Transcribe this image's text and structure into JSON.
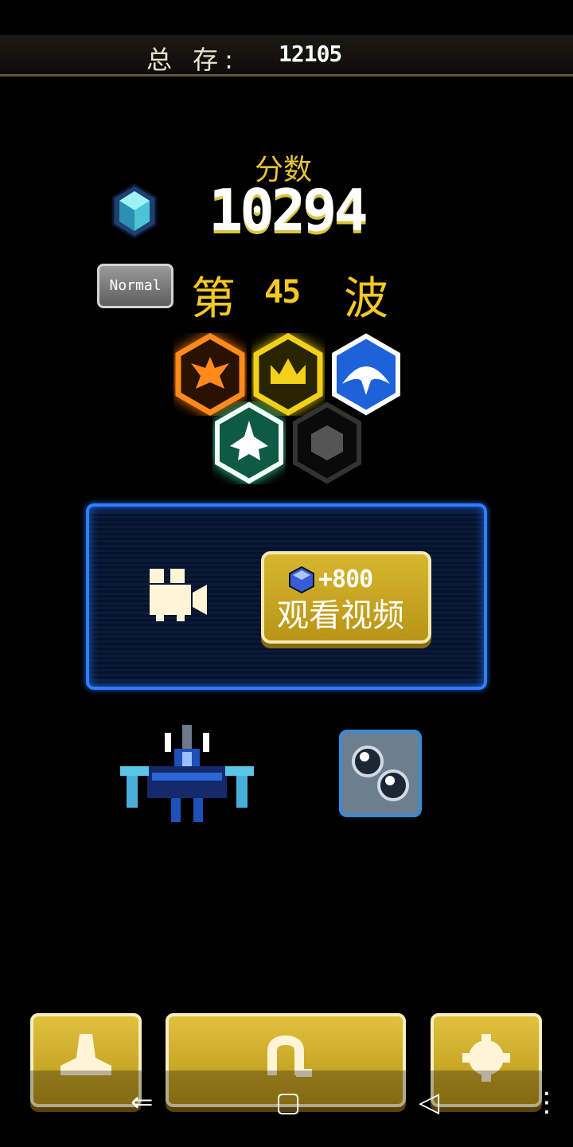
{
  "top_bar": {
    "total_label": "总 存:",
    "total_value": "12105"
  },
  "score": {
    "label": "分数",
    "value": "10294"
  },
  "difficulty": {
    "badge": "Normal"
  },
  "wave": {
    "prefix": "第",
    "number": "45",
    "suffix": "波"
  },
  "achievements": [
    {
      "name": "phoenix",
      "color": "#ff8a1a",
      "state": "unlocked"
    },
    {
      "name": "crown",
      "color": "#f2d11a",
      "state": "unlocked"
    },
    {
      "name": "manta",
      "color": "#1d62d8",
      "state": "unlocked"
    },
    {
      "name": "fighter",
      "color": "#1aa87a",
      "state": "unlocked"
    },
    {
      "name": "empty",
      "color": "#555555",
      "state": "locked"
    }
  ],
  "video_reward": {
    "amount": "+800",
    "caption": "观看视频"
  },
  "icons": {
    "gem": "blue-gem-icon",
    "camera": "video-camera-icon",
    "ship": "player-ship",
    "bullets": "bullet-upgrade-icon",
    "home": "ship-menu-icon",
    "retry": "restart-icon",
    "settings": "gear-icon"
  },
  "colors": {
    "accent_gold": "#f3c922",
    "panel_blue": "#2f7fff"
  },
  "nav": {
    "back": "⇐",
    "home": "▢",
    "recent": "◁",
    "menu": "⋮"
  }
}
